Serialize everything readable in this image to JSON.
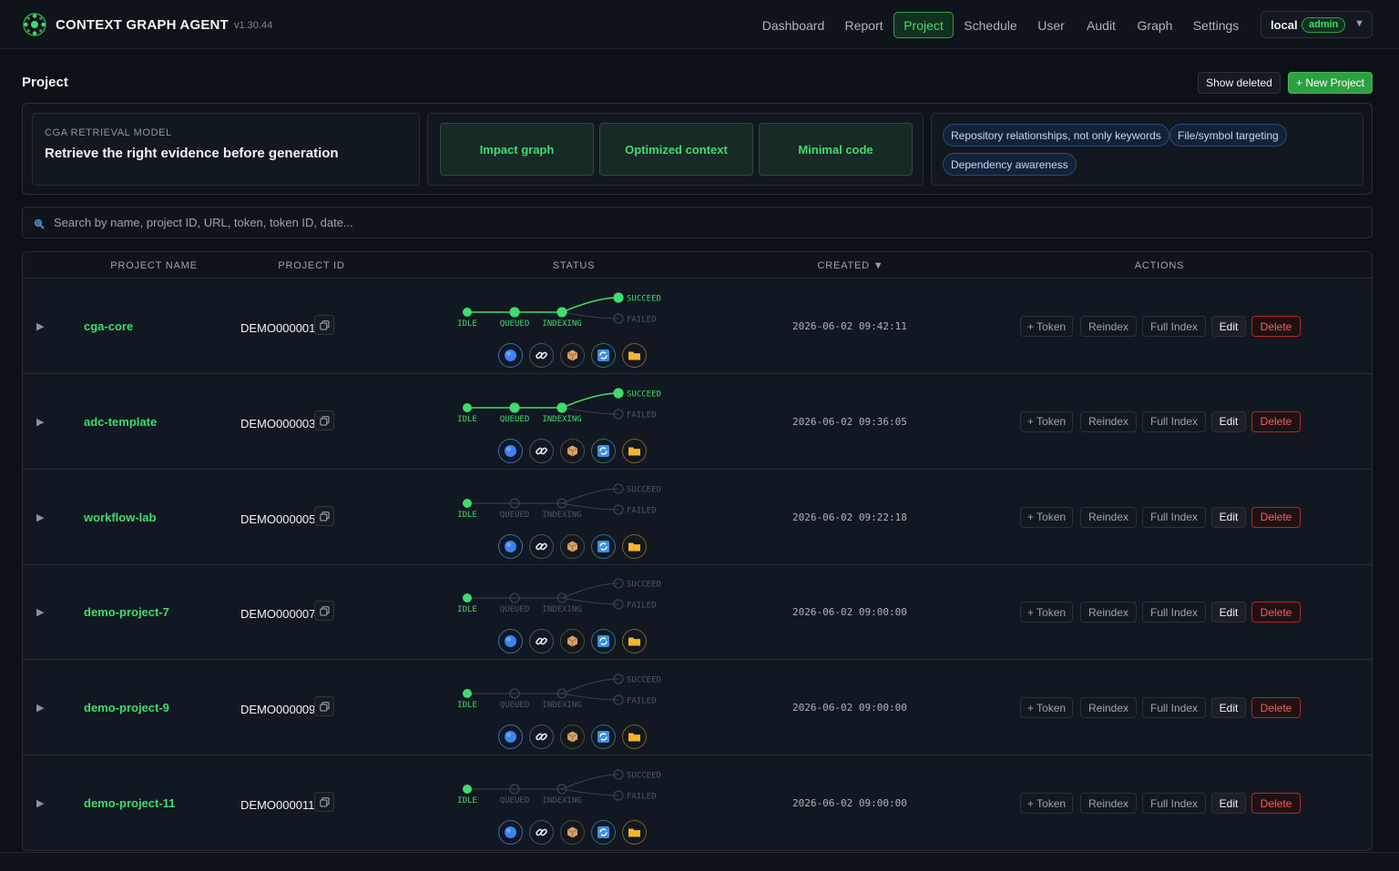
{
  "app": {
    "title": "CONTEXT GRAPH AGENT",
    "version": "v1.30.44"
  },
  "nav": [
    {
      "label": "Dashboard",
      "active": false
    },
    {
      "label": "Report",
      "active": false
    },
    {
      "label": "Project",
      "active": true
    },
    {
      "label": "Schedule",
      "active": false
    },
    {
      "label": "User",
      "active": false
    },
    {
      "label": "Audit",
      "active": false
    },
    {
      "label": "Graph",
      "active": false
    },
    {
      "label": "Settings",
      "active": false
    }
  ],
  "user": {
    "name": "local",
    "role": "admin",
    "caret": "▼"
  },
  "page": {
    "title": "Project",
    "show_deleted_label": "Show deleted",
    "new_project_label": "+ New Project"
  },
  "hero": {
    "kicker": "CGA RETRIEVAL MODEL",
    "headline": "Retrieve the right evidence before generation",
    "pipeline": [
      "Impact graph",
      "Optimized context",
      "Minimal code"
    ],
    "chips": [
      "Repository relationships, not only keywords",
      "File/symbol targeting",
      "Dependency awareness"
    ]
  },
  "search": {
    "placeholder": "Search by name, project ID, URL, token, token ID, date..."
  },
  "table": {
    "headers": {
      "name": "PROJECT NAME",
      "id": "PROJECT ID",
      "status": "STATUS",
      "created": "CREATED ▼",
      "actions": "ACTIONS"
    },
    "status_labels": {
      "idle": "IDLE",
      "queued": "QUEUED",
      "indexing": "INDEXING",
      "succeed": "SUCCEED",
      "failed": "FAILED"
    },
    "action_labels": {
      "token": "+ Token",
      "reindex": "Reindex",
      "full_index": "Full Index",
      "edit": "Edit",
      "delete": "Delete"
    },
    "rows": [
      {
        "name": "cga-core",
        "id": "DEMO000001",
        "created": "2026-06-02 09:42:11",
        "stage": "succeed"
      },
      {
        "name": "adc-template",
        "id": "DEMO000003",
        "created": "2026-06-02 09:36:05",
        "stage": "succeed"
      },
      {
        "name": "workflow-lab",
        "id": "DEMO000005",
        "created": "2026-06-02 09:22:18",
        "stage": "idle"
      },
      {
        "name": "demo-project-7",
        "id": "DEMO000007",
        "created": "2026-06-02 09:00:00",
        "stage": "idle"
      },
      {
        "name": "demo-project-9",
        "id": "DEMO000009",
        "created": "2026-06-02 09:00:00",
        "stage": "idle"
      },
      {
        "name": "demo-project-11",
        "id": "DEMO000011",
        "created": "2026-06-02 09:00:00",
        "stage": "idle"
      }
    ],
    "service_icons": [
      "globe-icon",
      "link-icon",
      "package-icon",
      "sync-icon",
      "folder-icon"
    ]
  },
  "colors": {
    "accent": "#3fdc6e",
    "danger": "#ff5a5a",
    "background": "#0d1117"
  }
}
